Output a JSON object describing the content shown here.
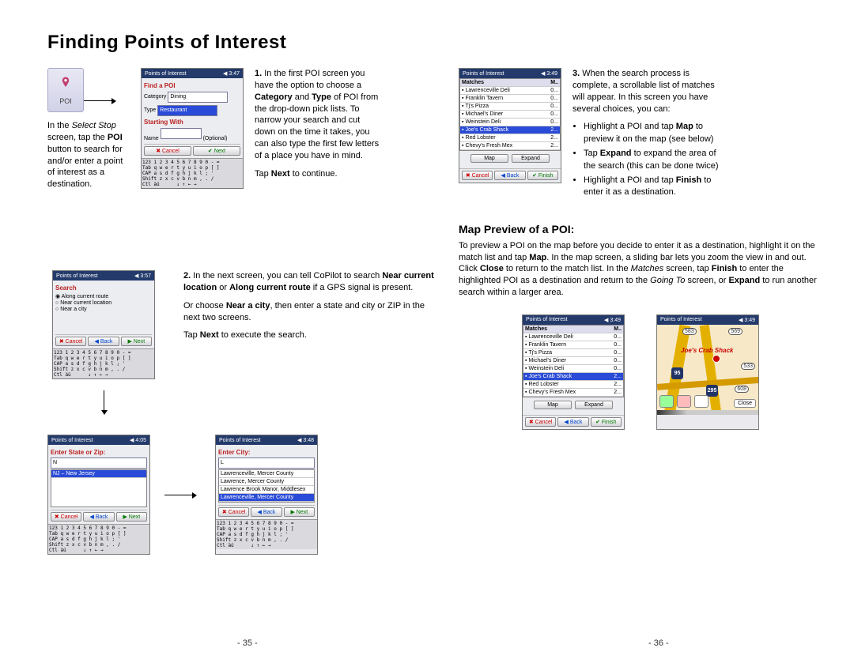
{
  "title": "Finding Points of Interest",
  "section2_title": "Map Preview of a POI:",
  "para_intro_pre": "In the ",
  "para_intro_it": "Select Stop",
  "para_intro_post": " screen, tap the ",
  "para_intro_b": "POI",
  "para_intro_end": " button to search for and/or enter a point of interest as a destination.",
  "p1_n": "1.",
  "p1_a": " In the first POI screen you have the option to choose a ",
  "p1_b1": "Category",
  "p1_mid": " and ",
  "p1_b2": "Type",
  "p1_c": " of POI from the drop-down pick lists. To narrow your search and cut down on the time it takes, you can also type the first few letters of a place you have in mind.",
  "p1_tap": "Tap ",
  "p1_next": "Next",
  "p1_cont": " to continue.",
  "p2_n": "2.",
  "p2_a": " In the next screen, you can tell CoPilot to search ",
  "p2_b1": "Near current location",
  "p2_or": " or ",
  "p2_b2": "Along current route",
  "p2_c": " if a GPS signal is present.",
  "p2_d_a": "Or choose ",
  "p2_d_b": "Near a city",
  "p2_d_c": ", then enter a state and city or ZIP in the next two screens.",
  "p2_e_a": "Tap ",
  "p2_e_b": "Next",
  "p2_e_c": " to execute the search.",
  "p3_n": "3.",
  "p3_a": " When the search process is complete, a scrollable list of matches will appear. In this screen you have several choices, you can:",
  "b1_a": "Highlight a POI and tap ",
  "b1_b": "Map",
  "b1_c": " to preview it on the map (see below)",
  "b2_a": "Tap ",
  "b2_b": "Expand",
  "b2_c": " to expand the area of the search (this can be done twice)",
  "b3_a": "Highlight a POI and tap ",
  "b3_b": "Finish",
  "b3_c": " to enter it as a destination.",
  "mp_a": "To preview a POI on the map before you decide to enter it as a destination, highlight it on the match list and tap ",
  "mp_b1": "Map",
  "mp_b": ". In the map screen, a sliding bar lets you zoom the view in and out. Click ",
  "mp_b2": "Close",
  "mp_c": " to return to the match list. In the ",
  "mp_it1": "Matches",
  "mp_d": " screen, tap ",
  "mp_b3": "Finish",
  "mp_e": " to enter the highlighted POI as a destination and return to the ",
  "mp_it2": "Going To",
  "mp_f": " screen, or ",
  "mp_b4": "Expand",
  "mp_g": " to run another search within a larger area.",
  "page_l": "- 35 -",
  "page_r": "- 36 -",
  "poi_btn": "POI",
  "pda_title": "Points of Interest",
  "time1": "3:47",
  "time2": "3:49",
  "time3": "3:57",
  "time4": "4:05",
  "time5": "3:48",
  "findpoi": "Find a POI",
  "cat_lbl": "Category",
  "cat_val": "Dining",
  "type_lbl": "Type",
  "type_val": "Restaurant",
  "start_lbl": "Starting With",
  "name_lbl": "Name",
  "opt": "(Optional)",
  "cancel": "Cancel",
  "back": "Back",
  "next": "Next",
  "finish": "Finish",
  "map": "Map",
  "expand": "Expand",
  "close": "Close",
  "search": "Search",
  "r1": "Along current route",
  "r2": "Near current location",
  "r3": "Near a city",
  "state_hd": "Enter State or Zip:",
  "state_v": "N",
  "state_l": "NJ – New Jersey",
  "city_hd": "Enter City:",
  "city_v": "L",
  "c1": "Lawrenceville, Mercer County",
  "c2": "Lawrence, Mercer County",
  "c3": "Lawrence Brook Manor, Middlesex",
  "c4": "Lawrenceville, Mercer County",
  "match": "Matches",
  "mcol": "M..",
  "m1": "Lawrenceville Deli",
  "m1d": "0...",
  "m2": "Franklin Tavern",
  "m2d": "0...",
  "m3": "Tj's Pizza",
  "m3d": "0...",
  "m4": "Michael's Diner",
  "m4d": "0...",
  "m5": "Weinstein Deli",
  "m5d": "0...",
  "m6": "Joe's Crab Shack",
  "m6d": "2...",
  "m7": "Red Lobster",
  "m7d": "2...",
  "m8": "Chevy's Fresh Mex",
  "m8d": "2...",
  "crab": "Joe's Crab Shack",
  "sh1": "95",
  "sh2": "295",
  "rn1": "583",
  "rn2": "569",
  "rn3": "533",
  "rn4": "608",
  "kb": "123 1 2 3 4 5 6 7 8 9 0 - =\nTab q w e r t y u i o p [ ]\nCAP a s d f g h j k l ; '\nShift z x c v b n m , . /\nCtl àü      ↓ ↑ ← →"
}
